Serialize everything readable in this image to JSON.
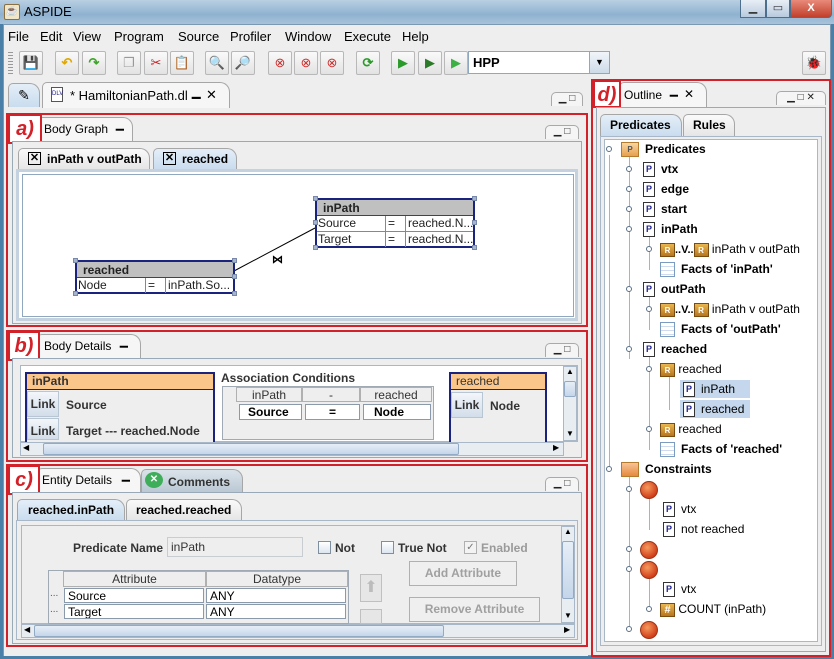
{
  "window": {
    "title": "ASPIDE",
    "minimize": "—",
    "maximize": "□",
    "close": "X"
  },
  "menubar": [
    "File",
    "Edit",
    "View",
    "Program",
    "Source",
    "Profiler",
    "Window",
    "Execute",
    "Help"
  ],
  "toolbar": {
    "buttons": [
      "save-icon",
      "undo-icon",
      "redo-icon",
      "copy-icon",
      "cut-icon",
      "paste-icon",
      "find-icon",
      "replace-icon",
      "remove-icon",
      "remove-multiple-icon",
      "remove-all-icon",
      "refresh-icon",
      "run-panel-icon",
      "run-debug-icon",
      "run-icon"
    ],
    "program_combo": "HPP",
    "debug_icon": "bug-icon"
  },
  "editor": {
    "tab_label": "* HamiltonianPath.dl",
    "tab_min": "▁",
    "tab_close": "✕"
  },
  "annotations": {
    "a": "a)",
    "b": "b)",
    "c": "c)",
    "d": "d)"
  },
  "body_graph": {
    "title": "Body Graph",
    "subtabs": [
      "inPath v outPath",
      "reached"
    ],
    "selected_subtab": "reached",
    "nodes": {
      "inPath": {
        "title": "inPath",
        "rows": [
          [
            "Source",
            "=",
            "reached.N..."
          ],
          [
            "Target",
            "=",
            "reached.N..."
          ]
        ]
      },
      "reached": {
        "title": "reached",
        "rows": [
          [
            "Node",
            "=",
            "inPath.So..."
          ]
        ]
      }
    },
    "join_symbol": "⋈"
  },
  "body_details": {
    "title": "Body Details",
    "left_entity": {
      "title": "inPath",
      "rows": [
        {
          "link": "Link",
          "text": "Source"
        },
        {
          "link": "Link",
          "text": "Target --- reached.Node"
        }
      ]
    },
    "association": {
      "title": "Association Conditions",
      "headers": [
        "inPath",
        "-",
        "reached"
      ],
      "rows": [
        [
          "Source",
          "=",
          "Node"
        ]
      ]
    },
    "right_entity": {
      "title": "reached",
      "rows": [
        {
          "link": "Link",
          "text": "Node"
        }
      ]
    }
  },
  "entity_details": {
    "title": "Entity Details",
    "comments_tab": "Comments",
    "subtabs": [
      "reached.inPath",
      "reached.reached"
    ],
    "selected_subtab": "reached.inPath",
    "predicate_name_label": "Predicate Name",
    "predicate_name_value": "inPath",
    "not_label": "Not",
    "not_checked": false,
    "true_not_label": "True Not",
    "true_not_checked": false,
    "enabled_label": "Enabled",
    "enabled_checked": true,
    "table": {
      "headers": [
        "Attribute",
        "Datatype"
      ],
      "rows": [
        [
          "...",
          "Source",
          "ANY"
        ],
        [
          "...",
          "Target",
          "ANY"
        ]
      ]
    },
    "add_attribute": "Add Attribute",
    "remove_attribute": "Remove Attribute"
  },
  "outline": {
    "title": "Outline",
    "tabs": [
      "Predicates",
      "Rules"
    ],
    "selected_tab": "Predicates",
    "tree": {
      "predicates_root": "Predicates",
      "items": [
        {
          "label": "vtx"
        },
        {
          "label": "edge"
        },
        {
          "label": "start"
        },
        {
          "label": "inPath",
          "rule": "inPath v outPath",
          "facts": "Facts of 'inPath'"
        },
        {
          "label": "outPath",
          "rule": "inPath v outPath",
          "facts": "Facts of 'outPath'"
        },
        {
          "label": "reached",
          "rule1": "reached",
          "rule1_children": [
            "inPath",
            "reached"
          ],
          "rule2": "reached",
          "facts": "Facts of 'reached'"
        }
      ],
      "constraints_root": "Constraints",
      "constraints": [
        {
          "children": [
            "vtx",
            "not reached"
          ]
        },
        {
          "children": []
        },
        {
          "children": [
            "vtx",
            "COUNT (inPath)"
          ]
        },
        {
          "children": []
        }
      ]
    }
  }
}
